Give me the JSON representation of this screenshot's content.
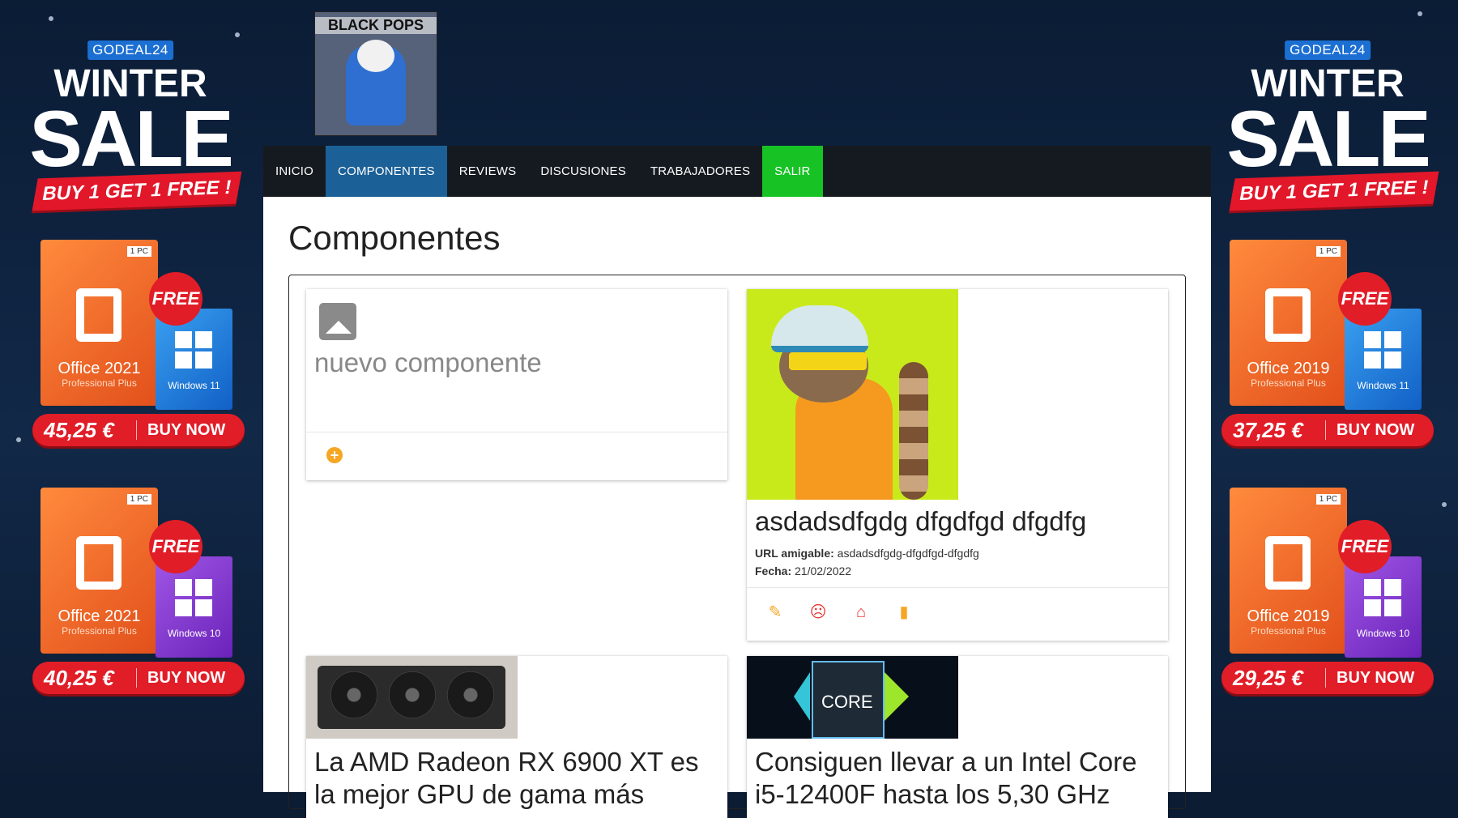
{
  "ads": {
    "brand": "GODEAL24",
    "winter": "WINTER",
    "sale": "SALE",
    "promo": "BUY 1 GET 1 FREE !",
    "free": "FREE",
    "cta": "BUY NOW",
    "pc_tag": "1 PC",
    "left": [
      {
        "office": "Office 2021",
        "office_sub": "Professional Plus",
        "windows": "Windows 11",
        "price": "45,25 €"
      },
      {
        "office": "Office 2021",
        "office_sub": "Professional Plus",
        "windows": "Windows 10",
        "price": "40,25 €"
      }
    ],
    "right": [
      {
        "office": "Office 2019",
        "office_sub": "Professional Plus",
        "windows": "Windows 11",
        "price": "37,25 €"
      },
      {
        "office": "Office 2019",
        "office_sub": "Professional Plus",
        "windows": "Windows 10",
        "price": "29,25 €"
      }
    ]
  },
  "site": {
    "logo_text": "BLACK POPS",
    "nav": [
      "INICIO",
      "COMPONENTES",
      "REVIEWS",
      "DISCUSIONES",
      "TRABAJADORES",
      "SALIR"
    ],
    "active_nav": "COMPONENTES",
    "page_title": "Componentes",
    "new_card": {
      "title": "nuevo componente"
    },
    "item": {
      "title": "asdadsdfgdg dfgdfgd dfgdfg",
      "url_label": "URL amigable:",
      "url_value": "asdadsdfgdg-dfgdfgd-dfgdfg",
      "date_label": "Fecha:",
      "date_value": "21/02/2022"
    },
    "gpu_card": {
      "title_line1": "La AMD Radeon RX 6900 XT es",
      "title_line2": "la mejor GPU de gama más"
    },
    "cpu_card": {
      "title_line1": "Consiguen llevar a un Intel Core",
      "title_line2": "i5-12400F hasta los 5,30 GHz",
      "cpu_label": "CORE"
    }
  },
  "colors": {
    "nav_active": "#1b6096",
    "nav_salir": "#17c225",
    "accent_orange": "#f5a623",
    "accent_red": "#e53935"
  }
}
